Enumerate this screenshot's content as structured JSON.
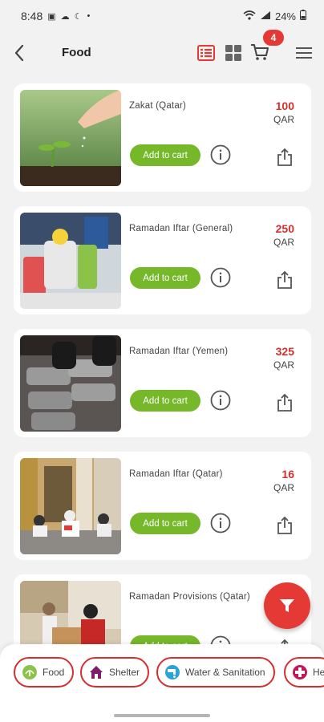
{
  "status_bar": {
    "time": "8:48",
    "battery": "24%",
    "icons": [
      "gallery-icon",
      "weather-icon",
      "moon-icon",
      "dot-icon",
      "wifi-icon",
      "signal-icon",
      "battery-icon"
    ]
  },
  "header": {
    "title": "Food",
    "cart_count": "4",
    "icons": [
      "back-arrow-icon",
      "list-view-icon",
      "grid-view-icon",
      "cart-icon",
      "hamburger-menu-icon"
    ],
    "colors": {
      "accent": "#e53935"
    }
  },
  "products": [
    {
      "title": "Zakat (Qatar)",
      "price": "100",
      "currency": "QAR",
      "add_label": "Add to cart"
    },
    {
      "title": "Ramadan Iftar (General)",
      "price": "250",
      "currency": "QAR",
      "add_label": "Add to cart"
    },
    {
      "title": "Ramadan Iftar (Yemen)",
      "price": "325",
      "currency": "QAR",
      "add_label": "Add to cart"
    },
    {
      "title": "Ramadan Iftar (Qatar)",
      "price": "16",
      "currency": "QAR",
      "add_label": "Add to cart"
    },
    {
      "title": "Ramadan Provisions (Qatar)",
      "price": "",
      "currency": "",
      "add_label": "Add to cart"
    }
  ],
  "categories": [
    {
      "label": "Food",
      "icon": "food-icon"
    },
    {
      "label": "Shelter",
      "icon": "house-icon"
    },
    {
      "label": "Water & Sanitation",
      "icon": "water-tap-icon"
    },
    {
      "label": "He",
      "icon": "health-icon"
    }
  ],
  "colors": {
    "primary_red": "#d32f2f",
    "button_green": "#76b82a",
    "background": "#f2f2f2"
  }
}
